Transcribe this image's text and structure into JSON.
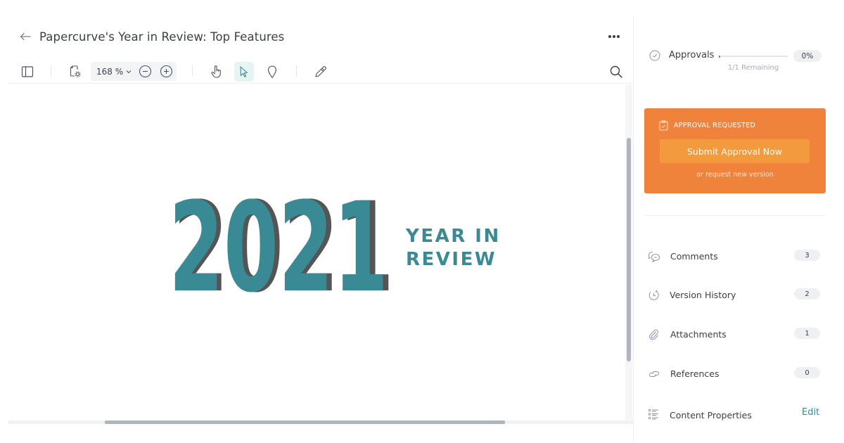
{
  "header": {
    "title": "Papercurve's Year in Review: Top Features",
    "back_icon": "arrow-left-icon",
    "more_icon": "more-horizontal-icon"
  },
  "toolbar": {
    "zoom_value": "168 %",
    "tools": [
      {
        "name": "sidebar-toggle",
        "icon": "panel-left-icon"
      },
      {
        "name": "page-settings",
        "icon": "page-gear-icon"
      },
      {
        "name": "zoom-out",
        "icon": "minus-circle-icon"
      },
      {
        "name": "zoom-in",
        "icon": "plus-circle-icon"
      },
      {
        "name": "pan-tool",
        "icon": "hand-pointer-icon"
      },
      {
        "name": "select-tool",
        "icon": "cursor-arrow-icon",
        "active": true
      },
      {
        "name": "pin-tool",
        "icon": "map-pin-icon"
      },
      {
        "name": "draw-tool",
        "icon": "pencil-icon"
      },
      {
        "name": "search",
        "icon": "search-icon"
      }
    ]
  },
  "document": {
    "year": "2021",
    "line1": "YEAR IN",
    "line2": "REVIEW",
    "brand_color": "#3a8a95",
    "shadow_color": "#555555"
  },
  "sidebar": {
    "approvals": {
      "label": "Approvals",
      "remaining": "1/1 Remaining",
      "percent_label": "0%",
      "progress": 0
    },
    "approval_card": {
      "title": "APPROVAL REQUESTED",
      "button": "Submit Approval Now",
      "link": "or request new version",
      "color": "#f0833c"
    },
    "items": [
      {
        "label": "Comments",
        "count": "3",
        "icon": "comments-icon"
      },
      {
        "label": "Version History",
        "count": "2",
        "icon": "history-icon"
      },
      {
        "label": "Attachments",
        "count": "1",
        "icon": "paperclip-icon"
      },
      {
        "label": "References",
        "count": "0",
        "icon": "link-icon"
      },
      {
        "label": "Content Properties",
        "action": "Edit",
        "icon": "list-icon"
      }
    ]
  }
}
